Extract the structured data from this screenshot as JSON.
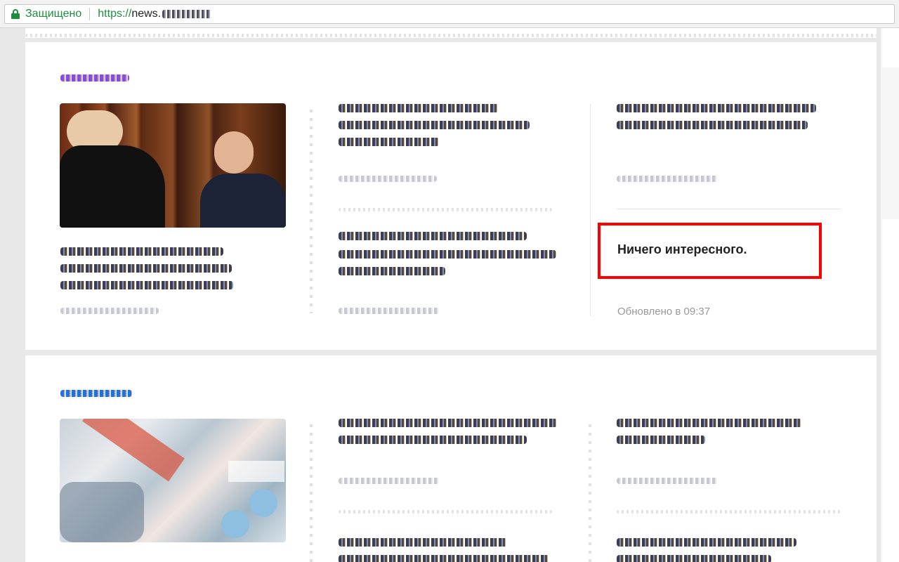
{
  "addressbar": {
    "secure_label": "Защищено",
    "url_scheme": "https://",
    "url_host": "news."
  },
  "block": {
    "empty_message": "Ничего интересного.",
    "updated_text": "Обновлено в 09:37"
  },
  "colors": {
    "secure_green": "#1e8e3e",
    "highlight_red": "#ff0000",
    "rubric_purple": "#8a4fd0",
    "rubric_blue": "#2a6fd6"
  }
}
